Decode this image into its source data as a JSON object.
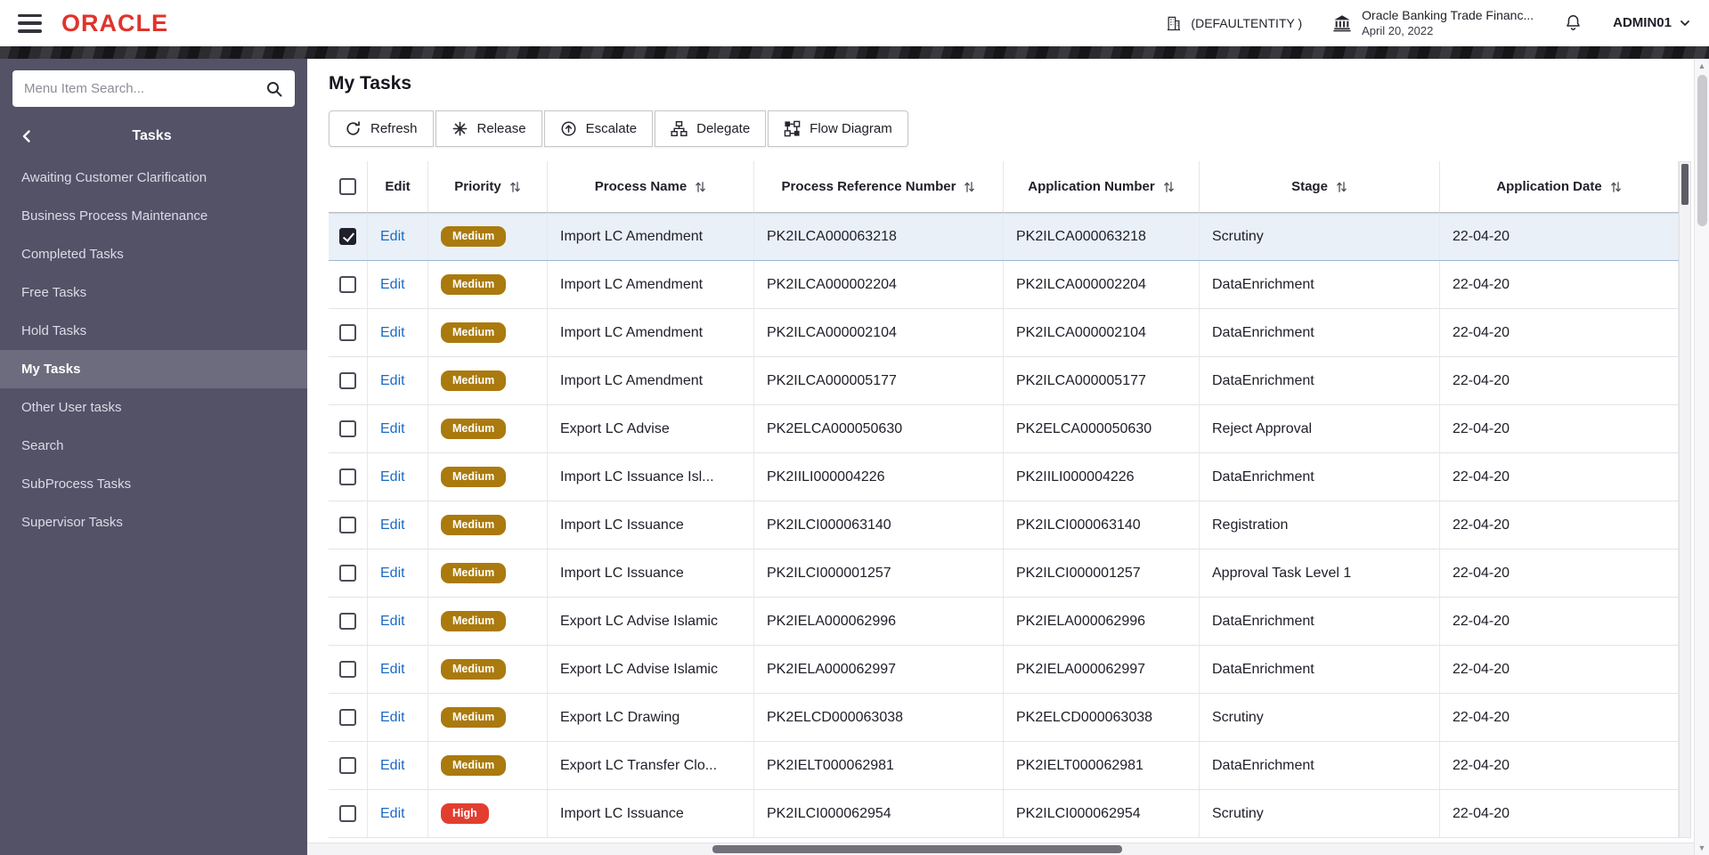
{
  "header": {
    "logo": "ORACLE",
    "entity_label": "(DEFAULTENTITY )",
    "product_name": "Oracle Banking Trade Financ...",
    "product_date": "April 20, 2022",
    "username": "ADMIN01"
  },
  "sidebar": {
    "search_placeholder": "Menu Item Search...",
    "section_title": "Tasks",
    "items": [
      {
        "label": "Awaiting Customer Clarification",
        "active": false
      },
      {
        "label": "Business Process Maintenance",
        "active": false
      },
      {
        "label": "Completed Tasks",
        "active": false
      },
      {
        "label": "Free Tasks",
        "active": false
      },
      {
        "label": "Hold Tasks",
        "active": false
      },
      {
        "label": "My Tasks",
        "active": true
      },
      {
        "label": "Other User tasks",
        "active": false
      },
      {
        "label": "Search",
        "active": false
      },
      {
        "label": "SubProcess Tasks",
        "active": false
      },
      {
        "label": "Supervisor Tasks",
        "active": false
      }
    ]
  },
  "main": {
    "title": "My Tasks",
    "toolbar": [
      {
        "label": "Refresh",
        "icon": "refresh-icon"
      },
      {
        "label": "Release",
        "icon": "release-icon"
      },
      {
        "label": "Escalate",
        "icon": "escalate-icon"
      },
      {
        "label": "Delegate",
        "icon": "delegate-icon"
      },
      {
        "label": "Flow Diagram",
        "icon": "flow-diagram-icon"
      }
    ],
    "table": {
      "columns": [
        {
          "label": "Edit",
          "sortable": false
        },
        {
          "label": "Priority",
          "sortable": true
        },
        {
          "label": "Process Name",
          "sortable": true
        },
        {
          "label": "Process Reference Number",
          "sortable": true
        },
        {
          "label": "Application Number",
          "sortable": true
        },
        {
          "label": "Stage",
          "sortable": true
        },
        {
          "label": "Application Date",
          "sortable": true
        }
      ],
      "rows": [
        {
          "selected": true,
          "edit_label": "Edit",
          "priority": "Medium",
          "process_name": "Import LC Amendment",
          "process_reference_number": "PK2ILCA000063218",
          "application_number": "PK2ILCA000063218",
          "stage": "Scrutiny",
          "application_date": "22-04-20"
        },
        {
          "selected": false,
          "edit_label": "Edit",
          "priority": "Medium",
          "process_name": "Import LC Amendment",
          "process_reference_number": "PK2ILCA000002204",
          "application_number": "PK2ILCA000002204",
          "stage": "DataEnrichment",
          "application_date": "22-04-20"
        },
        {
          "selected": false,
          "edit_label": "Edit",
          "priority": "Medium",
          "process_name": "Import LC Amendment",
          "process_reference_number": "PK2ILCA000002104",
          "application_number": "PK2ILCA000002104",
          "stage": "DataEnrichment",
          "application_date": "22-04-20"
        },
        {
          "selected": false,
          "edit_label": "Edit",
          "priority": "Medium",
          "process_name": "Import LC Amendment",
          "process_reference_number": "PK2ILCA000005177",
          "application_number": "PK2ILCA000005177",
          "stage": "DataEnrichment",
          "application_date": "22-04-20"
        },
        {
          "selected": false,
          "edit_label": "Edit",
          "priority": "Medium",
          "process_name": "Export LC Advise",
          "process_reference_number": "PK2ELCA000050630",
          "application_number": "PK2ELCA000050630",
          "stage": "Reject Approval",
          "application_date": "22-04-20"
        },
        {
          "selected": false,
          "edit_label": "Edit",
          "priority": "Medium",
          "process_name": "Import LC Issuance Isl...",
          "process_reference_number": "PK2IILI000004226",
          "application_number": "PK2IILI000004226",
          "stage": "DataEnrichment",
          "application_date": "22-04-20"
        },
        {
          "selected": false,
          "edit_label": "Edit",
          "priority": "Medium",
          "process_name": "Import LC Issuance",
          "process_reference_number": "PK2ILCI000063140",
          "application_number": "PK2ILCI000063140",
          "stage": "Registration",
          "application_date": "22-04-20"
        },
        {
          "selected": false,
          "edit_label": "Edit",
          "priority": "Medium",
          "process_name": "Import LC Issuance",
          "process_reference_number": "PK2ILCI000001257",
          "application_number": "PK2ILCI000001257",
          "stage": "Approval Task Level 1",
          "application_date": "22-04-20"
        },
        {
          "selected": false,
          "edit_label": "Edit",
          "priority": "Medium",
          "process_name": "Export LC Advise Islamic",
          "process_reference_number": "PK2IELA000062996",
          "application_number": "PK2IELA000062996",
          "stage": "DataEnrichment",
          "application_date": "22-04-20"
        },
        {
          "selected": false,
          "edit_label": "Edit",
          "priority": "Medium",
          "process_name": "Export LC Advise Islamic",
          "process_reference_number": "PK2IELA000062997",
          "application_number": "PK2IELA000062997",
          "stage": "DataEnrichment",
          "application_date": "22-04-20"
        },
        {
          "selected": false,
          "edit_label": "Edit",
          "priority": "Medium",
          "process_name": "Export LC Drawing",
          "process_reference_number": "PK2ELCD000063038",
          "application_number": "PK2ELCD000063038",
          "stage": "Scrutiny",
          "application_date": "22-04-20"
        },
        {
          "selected": false,
          "edit_label": "Edit",
          "priority": "Medium",
          "process_name": "Export LC Transfer Clo...",
          "process_reference_number": "PK2IELT000062981",
          "application_number": "PK2IELT000062981",
          "stage": "DataEnrichment",
          "application_date": "22-04-20"
        },
        {
          "selected": false,
          "edit_label": "Edit",
          "priority": "High",
          "process_name": "Import LC Issuance",
          "process_reference_number": "PK2ILCI000062954",
          "application_number": "PK2ILCI000062954",
          "stage": "Scrutiny",
          "application_date": "22-04-20"
        }
      ]
    }
  },
  "colors": {
    "brand_red": "#e0332c",
    "sidebar_bg": "#535267",
    "sidebar_active_bg": "#6d6c7e",
    "link_blue": "#1a6ac4",
    "priority_medium": "#aa7a0e",
    "priority_high": "#e23e30",
    "selected_row_bg": "#e9f0f8"
  }
}
